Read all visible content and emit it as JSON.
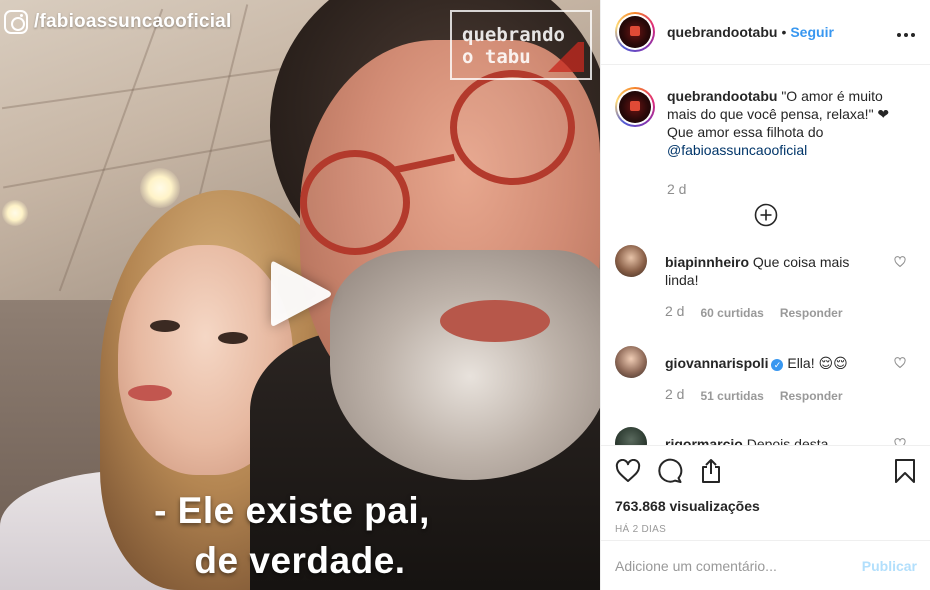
{
  "video": {
    "watermark": "/fabioassuncaooficial",
    "logo_text_line1": "quebrando",
    "logo_text_line2": "o tabu",
    "subtitle_line1": "- Ele existe pai,",
    "subtitle_line2": "de verdade."
  },
  "header": {
    "username": "quebrandootabu",
    "separator": "•",
    "follow_label": "Seguir",
    "more_label": "•••"
  },
  "caption": {
    "username": "quebrandootabu",
    "text": "\"O amor é muito mais do que você pensa, relaxa!\" ❤ Que amor essa filhota do",
    "mention": "@fabioassuncaooficial",
    "time": "2 d"
  },
  "comments": [
    {
      "username": "biapinnheiro",
      "text": "Que coisa mais linda!",
      "time": "2 d",
      "likes": "60 curtidas",
      "reply": "Responder",
      "verified": false
    },
    {
      "username": "giovannarispoli",
      "text": "Ella! 😌😌",
      "time": "2 d",
      "likes": "51 curtidas",
      "reply": "Responder",
      "verified": true
    },
    {
      "username": "rigormarcio",
      "text": "Depois desta",
      "verified": false
    }
  ],
  "stats": {
    "views": "763.868 visualizações",
    "posted": "HÁ 2 DIAS"
  },
  "comment_box": {
    "placeholder": "Adicione um comentário...",
    "publish_label": "Publicar"
  },
  "colors": {
    "link_blue": "#3897f0",
    "publish_disabled": "#b2dffc",
    "muted": "#8e8e8e"
  }
}
